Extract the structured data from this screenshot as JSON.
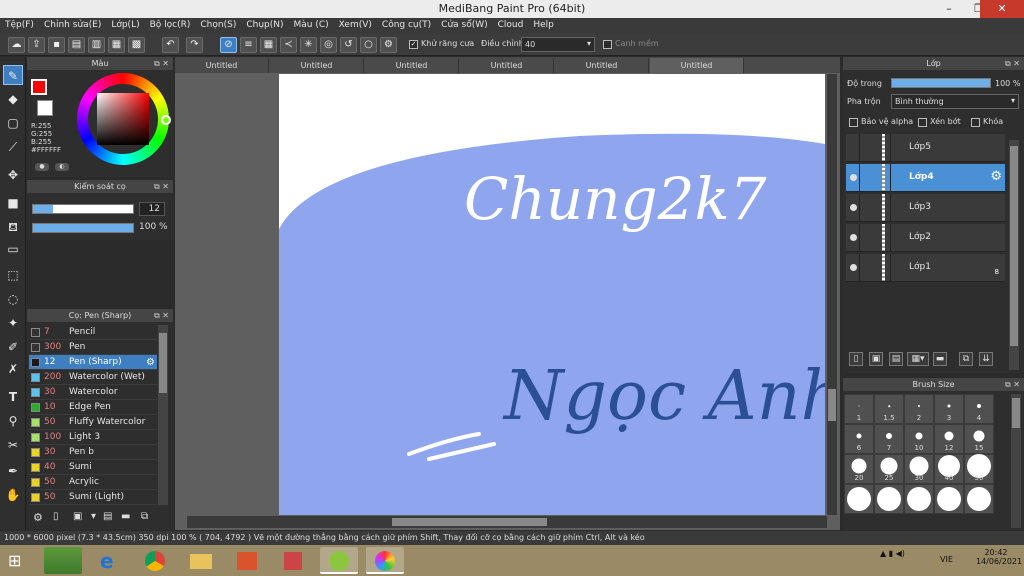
{
  "window": {
    "title": "MediBang Paint Pro (64bit)",
    "minimize": "–",
    "restore": "❐",
    "close": "✕"
  },
  "menu": [
    "Tệp(F)",
    "Chỉnh sửa(E)",
    "Lớp(L)",
    "Bộ lọc(R)",
    "Chọn(S)",
    "Chụp(N)",
    "Màu (C)",
    "Xem(V)",
    "Công cụ(T)",
    "Cửa sổ(W)",
    "Cloud",
    "Help"
  ],
  "toolbar": {
    "antialias_label": "Khử răng cưa",
    "correction_label": "Điều chỉnh",
    "correction_value": "40",
    "edge_label": "Canh mềm"
  },
  "color_panel": {
    "title": "Màu",
    "r": "R:255",
    "g": "G:255",
    "b": "B:255",
    "hex": "#FFFFFF",
    "fg_color": "#ff0000",
    "bg_color": "#ffffff"
  },
  "brush_control": {
    "title": "Kiểm soát cọ",
    "size_value": "12",
    "opacity_value": "100 %",
    "size_fraction": 0.2,
    "opacity_fraction": 1.0
  },
  "brush_list": {
    "title": "Cọ: Pen (Sharp)",
    "items": [
      {
        "num": "7",
        "name": "Pencil",
        "color": "#333333"
      },
      {
        "num": "300",
        "name": "Pen",
        "color": "#333333"
      },
      {
        "num": "12",
        "name": "Pen (Sharp)",
        "color": "#1a1a1a"
      },
      {
        "num": "200",
        "name": "Watercolor (Wet)",
        "color": "#5bc3ee"
      },
      {
        "num": "30",
        "name": "Watercolor",
        "color": "#5bc3ee"
      },
      {
        "num": "10",
        "name": "Edge Pen",
        "color": "#2faa2f"
      },
      {
        "num": "50",
        "name": "Fluffy Watercolor",
        "color": "#a8e06a"
      },
      {
        "num": "100",
        "name": "Light 3",
        "color": "#a8e06a"
      },
      {
        "num": "30",
        "name": " Pen b",
        "color": "#e8d22a"
      },
      {
        "num": "40",
        "name": "Sumi",
        "color": "#e8d22a"
      },
      {
        "num": "50",
        "name": "Acrylic",
        "color": "#e8d22a"
      },
      {
        "num": "50",
        "name": "Sumi (Light)",
        "color": "#e8d22a"
      }
    ]
  },
  "tabs": [
    "Untitled",
    "Untitled",
    "Untitled",
    "Untitled",
    "Untitled",
    "Untitled"
  ],
  "artwork": {
    "line1": "Chung2k7",
    "line2": "Ngọc Anh"
  },
  "layer_panel": {
    "title": "Lớp",
    "opacity_label": "Độ trong",
    "opacity_value": "100 %",
    "blend_label": "Pha trộn",
    "blend_value": "Bình thường",
    "protect_alpha": "Bảo vệ alpha",
    "clipping": "Xén bớt",
    "lock": "Khóa",
    "layers": [
      "Lớp5",
      "Lớp4",
      "Lớp3",
      "Lớp2",
      "Lớp1"
    ],
    "layer1_badge": "8"
  },
  "brush_size": {
    "title": "Brush Size",
    "sizes": [
      "1",
      "1.5",
      "2",
      "3",
      "4",
      "6",
      "7",
      "10",
      "12",
      "15",
      "20",
      "25",
      "30",
      "40",
      "50",
      "",
      "",
      "",
      "",
      ""
    ]
  },
  "status": {
    "text": "1000 * 6000 pixel   (7.3 * 43.5cm)   350 dpi   100 %   ( 704, 4792 )   Vẽ một đường thẳng bằng cách giữ phím Shift, Thay đổi cỡ cọ bằng cách giữ phím Ctrl, Alt và kéo"
  },
  "taskbar": {
    "lang": "VIE",
    "time": "20:42",
    "date": "14/06/2021"
  }
}
